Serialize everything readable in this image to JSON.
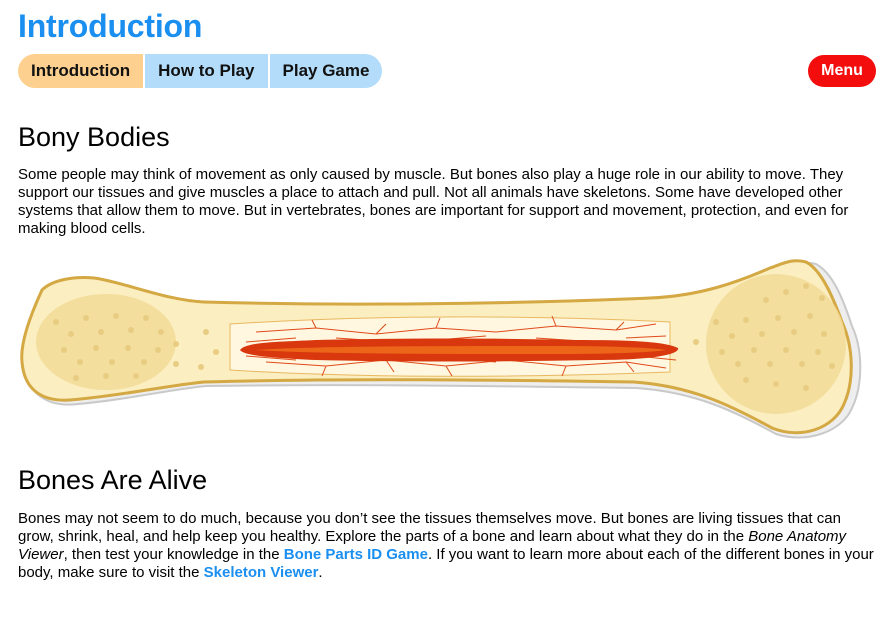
{
  "header": {
    "title": "Introduction"
  },
  "tabs": [
    {
      "label": "Introduction",
      "active": true
    },
    {
      "label": "How to Play",
      "active": false
    },
    {
      "label": "Play Game",
      "active": false
    }
  ],
  "menu_label": "Menu",
  "section1": {
    "heading": "Bony Bodies",
    "text": "Some people may think of movement as only caused by muscle. But bones also play a huge role in our ability to move. They support our tissues and give muscles a place to attach and pull. Not all animals have skeletons. Some have developed other systems that allow them to move. But in vertebrates, bones are important for support and movement, protection, and even for making blood cells."
  },
  "section2": {
    "heading": "Bones Are Alive",
    "text_a": "Bones may not seem to do much, because you don’t see the tissues themselves move. But bones are living tissues that can grow, shrink, heal, and help keep you healthy. Explore the parts of a bone and learn about what they do in the ",
    "italic": "Bone Anatomy Viewer",
    "text_b": ", then test your knowledge in the ",
    "link1": "Bone Parts ID Game",
    "text_c": ". If you want to learn more about each of the different bones in your body, make sure to visit the ",
    "link2": "Skeleton Viewer",
    "text_d": "."
  },
  "colors": {
    "accent": "#1a8ff0",
    "tab_active": "#fdd08f",
    "tab_inactive": "#b3dcfa",
    "menu": "#f40d0d",
    "bone_fill": "#fbeec0",
    "bone_outline": "#d4a843",
    "marrow": "#d9380f"
  },
  "icons": {
    "illustration": "long-bone-cross-section-illustration"
  }
}
